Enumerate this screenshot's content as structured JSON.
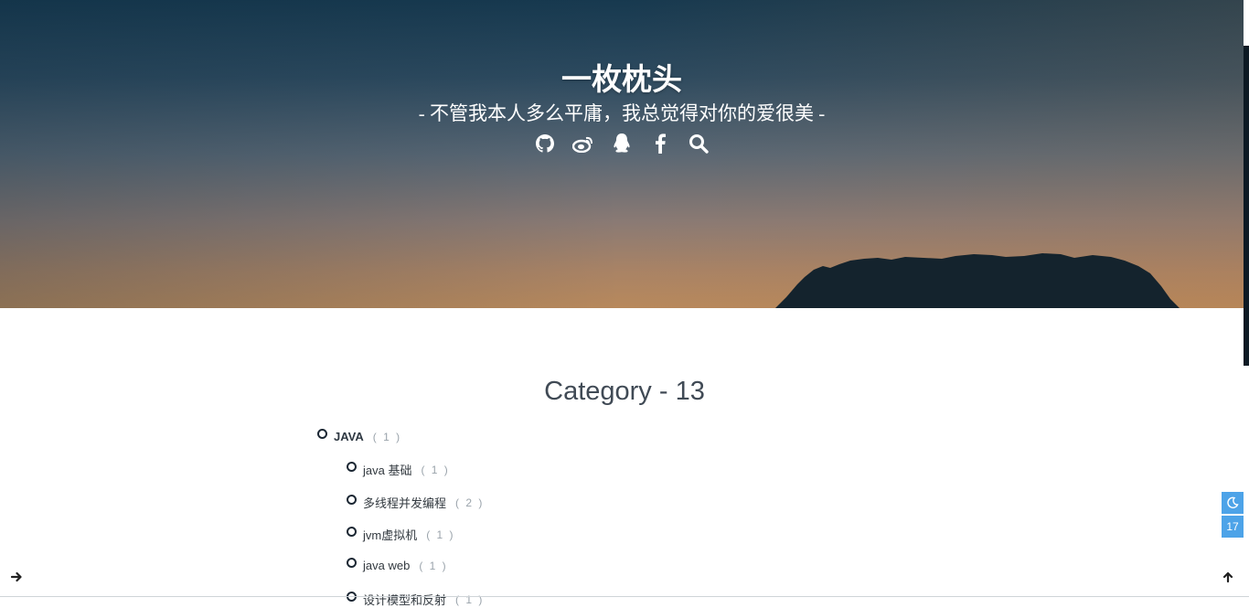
{
  "header": {
    "title": "一枚枕头",
    "subtitle": "- 不管我本人多么平庸，我总觉得对你的爱很美 -",
    "social_icons": [
      "github-icon",
      "weibo-icon",
      "qq-icon",
      "facebook-icon",
      "search-icon"
    ]
  },
  "category": {
    "heading": "Category - 13",
    "items": [
      {
        "name": "JAVA",
        "count": "( 1 )",
        "level": 0
      },
      {
        "name": "java 基础",
        "count": "( 1 )",
        "level": 1
      },
      {
        "name": "多线程并发编程",
        "count": "( 2 )",
        "level": 1
      },
      {
        "name": "jvm虚拟机",
        "count": "( 1 )",
        "level": 1
      },
      {
        "name": "java web",
        "count": "( 1 )",
        "level": 1
      },
      {
        "name": "设计模型和反射",
        "count": "( 1 )",
        "level": 1
      }
    ]
  },
  "float_buttons": {
    "dark_mode_icon": "moon-icon",
    "progress": "17"
  },
  "corner_buttons": {
    "left_icon": "arrow-right-icon",
    "right_icon": "arrow-up-icon"
  },
  "colors": {
    "accent": "#4da3e8",
    "header_top": "#17394f",
    "header_bottom": "#b8895c"
  }
}
